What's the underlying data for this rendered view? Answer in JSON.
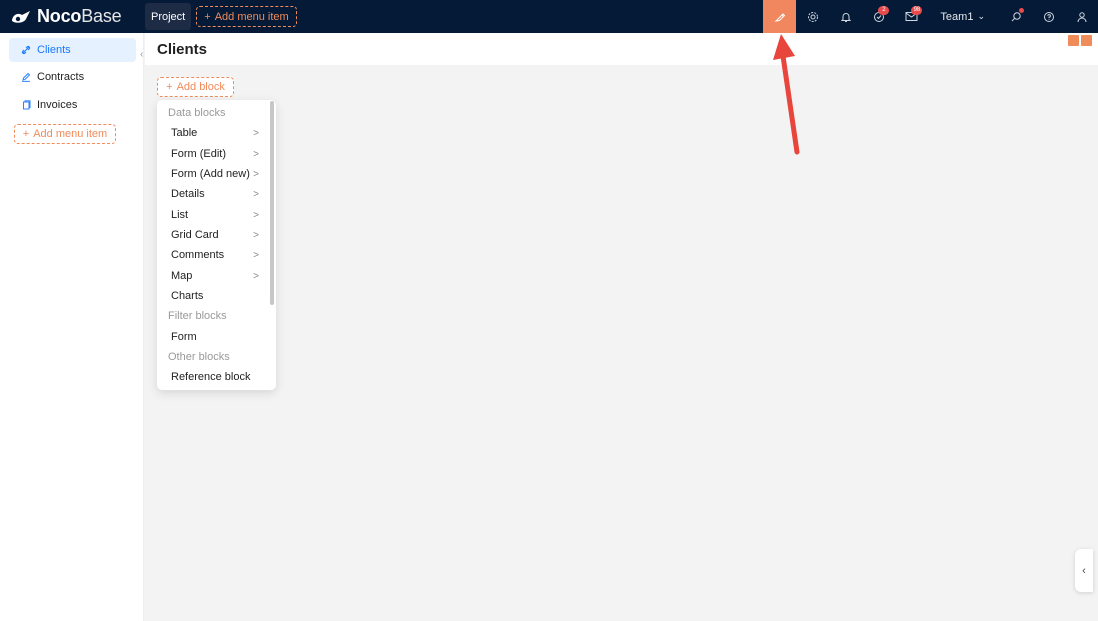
{
  "topbar": {
    "logo_bold": "Noco",
    "logo_light": "Base",
    "project_tab": "Project",
    "add_menu_item": "Add menu item",
    "badges": {
      "tasks": "2",
      "messages": "98"
    },
    "team": "Team1",
    "colors": {
      "background": "#041a36",
      "active_icon": "#f0875f",
      "accent": "#f08b5a"
    }
  },
  "sidebar": {
    "items": [
      {
        "label": "Clients",
        "icon": "link-icon",
        "active": true
      },
      {
        "label": "Contracts",
        "icon": "edit-icon",
        "active": false
      },
      {
        "label": "Invoices",
        "icon": "copy-icon",
        "active": false
      }
    ],
    "add_menu_item": "Add menu item"
  },
  "page": {
    "title": "Clients",
    "add_block": "Add block"
  },
  "block_menu": {
    "groups": [
      {
        "title": "Data blocks",
        "items": [
          "Table",
          "Form (Edit)",
          "Form (Add new)",
          "Details",
          "List",
          "Grid Card",
          "Comments",
          "Map",
          "Charts"
        ]
      },
      {
        "title": "Filter blocks",
        "items": [
          "Form"
        ]
      },
      {
        "title": "Other blocks",
        "items": [
          "Reference block"
        ]
      }
    ]
  }
}
